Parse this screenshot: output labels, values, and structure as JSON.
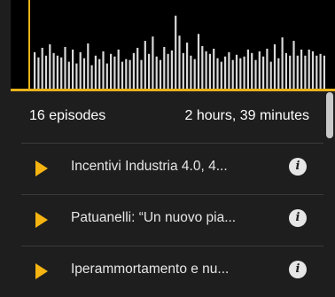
{
  "player": {
    "waveform_level": [
      0.42,
      0.36,
      0.47,
      0.38,
      0.51,
      0.41,
      0.38,
      0.36,
      0.48,
      0.31,
      0.45,
      0.29,
      0.42,
      0.35,
      0.52,
      0.27,
      0.38,
      0.34,
      0.43,
      0.29,
      0.4,
      0.37,
      0.45,
      0.31,
      0.34,
      0.33,
      0.41,
      0.47,
      0.33,
      0.55,
      0.4,
      0.6,
      0.37,
      0.33,
      0.48,
      0.4,
      0.44,
      0.84,
      0.61,
      0.41,
      0.53,
      0.38,
      0.34,
      0.63,
      0.49,
      0.43,
      0.4,
      0.46,
      0.35,
      0.31,
      0.37,
      0.42,
      0.33,
      0.39,
      0.35,
      0.37,
      0.45,
      0.41,
      0.33,
      0.43,
      0.37,
      0.46,
      0.31,
      0.51,
      0.35,
      0.59,
      0.41,
      0.38,
      0.55,
      0.38,
      0.45,
      0.38,
      0.45,
      0.43,
      0.38,
      0.4,
      0.38
    ],
    "colors": {
      "accent": "#f5b412",
      "bars": "#d9d9d9",
      "background": "#000000"
    }
  },
  "summary": {
    "episode_count": "16 episodes",
    "total_duration": "2 hours, 39 minutes"
  },
  "episodes": [
    {
      "title": "Incentivi Industria 4.0, 4...",
      "play_icon": "play-icon",
      "info_icon": "info-icon",
      "info_glyph": "i"
    },
    {
      "title": "Patuanelli: “Un nuovo pia...",
      "play_icon": "play-icon",
      "info_icon": "info-icon",
      "info_glyph": "i"
    },
    {
      "title": "Iperammortamento e nu...",
      "play_icon": "play-icon",
      "info_icon": "info-icon",
      "info_glyph": "i"
    }
  ]
}
